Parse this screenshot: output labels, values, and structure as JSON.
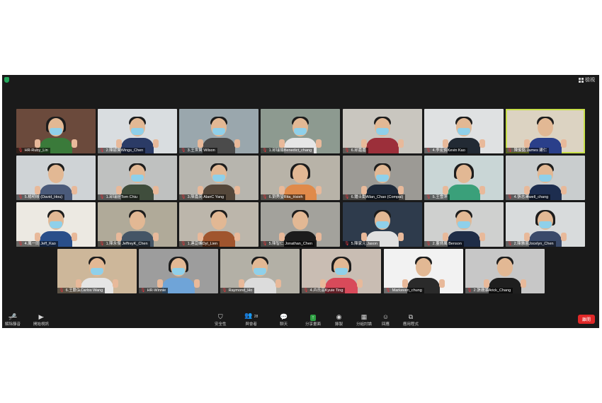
{
  "window": {
    "view_label": "檢視"
  },
  "participants": [
    {
      "name": "HR-Ruby_Lin",
      "bg": "#6b4a3c",
      "shirt": "#3a7a3a",
      "mask": true,
      "fem": true
    },
    {
      "name": "2.陳諺賢Wings_Chen",
      "bg": "#d9dde0",
      "shirt": "#2b3b66",
      "mask": true
    },
    {
      "name": "3.王世賢 Wilson",
      "bg": "#9aa7ad",
      "shirt": "#4b4b4b",
      "mask": true
    },
    {
      "name": "1.邱瑞揚Benedict_chang",
      "bg": "#8d9a90",
      "shirt": "#e6e6e6",
      "mask": true
    },
    {
      "name": "6.邱嘉嘉",
      "bg": "#c9c6bf",
      "shirt": "#9c2f3a",
      "mask": true
    },
    {
      "name": "4.李宏賓Kevin Kao",
      "bg": "#dfe1e2",
      "shirt": "#222a34",
      "mask": true
    },
    {
      "name": "陳俊銘 James 建仁",
      "bg": "#dcd3c2",
      "shirt": "#2a3f8a",
      "mask": false,
      "active": true
    },
    {
      "name": "5.楊明岐 (David_Hou)",
      "bg": "#cfd3d6",
      "shirt": "#4a5a7a",
      "mask": false
    },
    {
      "name": "1.邱瑞詮Tom Chiu",
      "bg": "#bfc1c0",
      "shirt": "#3f4d3c",
      "mask": true
    },
    {
      "name": "3.陳嘉亮 AlanC Yang",
      "bg": "#b7b5ae",
      "shirt": "#54473a",
      "mask": true
    },
    {
      "name": "6.劉秀瑩Rita_Hsieh",
      "bg": "#b8b3a8",
      "shirt": "#e08a4a",
      "mask": false,
      "fem": true
    },
    {
      "name": "6.鍾士勳Allan_Chao (Compal)",
      "bg": "#9c9a95",
      "shirt": "#1f2a3a",
      "mask": true
    },
    {
      "name": "5.王雪萍",
      "bg": "#c9d6d6",
      "shirt": "#3aa07a",
      "mask": false,
      "fem": true
    },
    {
      "name": "4.張志澤well_chang",
      "bg": "#c9cdce",
      "shirt": "#1d2d4f",
      "mask": true
    },
    {
      "name": "4.萬一同 Jeff_Kao",
      "bg": "#ece9e2",
      "shirt": "#2a4f8a",
      "mask": true
    },
    {
      "name": "1.陳永傑 JeffreyK_Chen",
      "bg": "#b0aa99",
      "shirt": "#445566",
      "mask": false
    },
    {
      "name": "1.連崑峰Dyl_Lien",
      "bg": "#bcb6ab",
      "shirt": "#a0552e",
      "mask": false
    },
    {
      "name": "5.陳智仁 Jonathan_Chen",
      "bg": "#a3a29c",
      "shirt": "#1c1c1c",
      "mask": false
    },
    {
      "name": "5.陳家元 Jason",
      "bg": "#2e3b4c",
      "shirt": "#e0e0e0",
      "mask": true
    },
    {
      "name": "2.董倩萬 Benson",
      "bg": "#cfd0cf",
      "shirt": "#1f2d47",
      "mask": true
    },
    {
      "name": "2.陳雅恩Jocelyn_Chen",
      "bg": "#d8dbdc",
      "shirt": "#3a4a6a",
      "mask": true,
      "fem": true
    },
    {
      "name": "6.王勳弘Carlos Wang",
      "bg": "#cdb79a",
      "shirt": "#e5e5e5",
      "mask": true
    },
    {
      "name": "HR-Winnie",
      "bg": "#9d9d9d",
      "shirt": "#6fa4d8",
      "mask": true,
      "fem": true
    },
    {
      "name": "Raymond_Ho",
      "bg": "#b3b0a6",
      "shirt": "#dcdcdc",
      "mask": true
    },
    {
      "name": "4.卉氏芸Kyuie Ting",
      "bg": "#c9bdb3",
      "shirt": "#d84a5a",
      "mask": true,
      "fem": true
    },
    {
      "name": "Markeven_chung",
      "bg": "#f2f2f2",
      "shirt": "#2a2a2a",
      "mask": false
    },
    {
      "name": "2.張珊灝Arick_Chang",
      "bg": "#c7c7c7",
      "shirt": "#1e1e1e",
      "mask": false
    }
  ],
  "toolbar": {
    "unmute": "解除靜音",
    "start_video": "開始視訊",
    "security": "安全性",
    "participants": "與會者",
    "participants_count": "28",
    "chat": "聊天",
    "share_screen": "分享畫面",
    "record": "錄製",
    "breakout": "分組討論",
    "reactions": "回應",
    "apps": "應用程式",
    "end": "離開"
  }
}
